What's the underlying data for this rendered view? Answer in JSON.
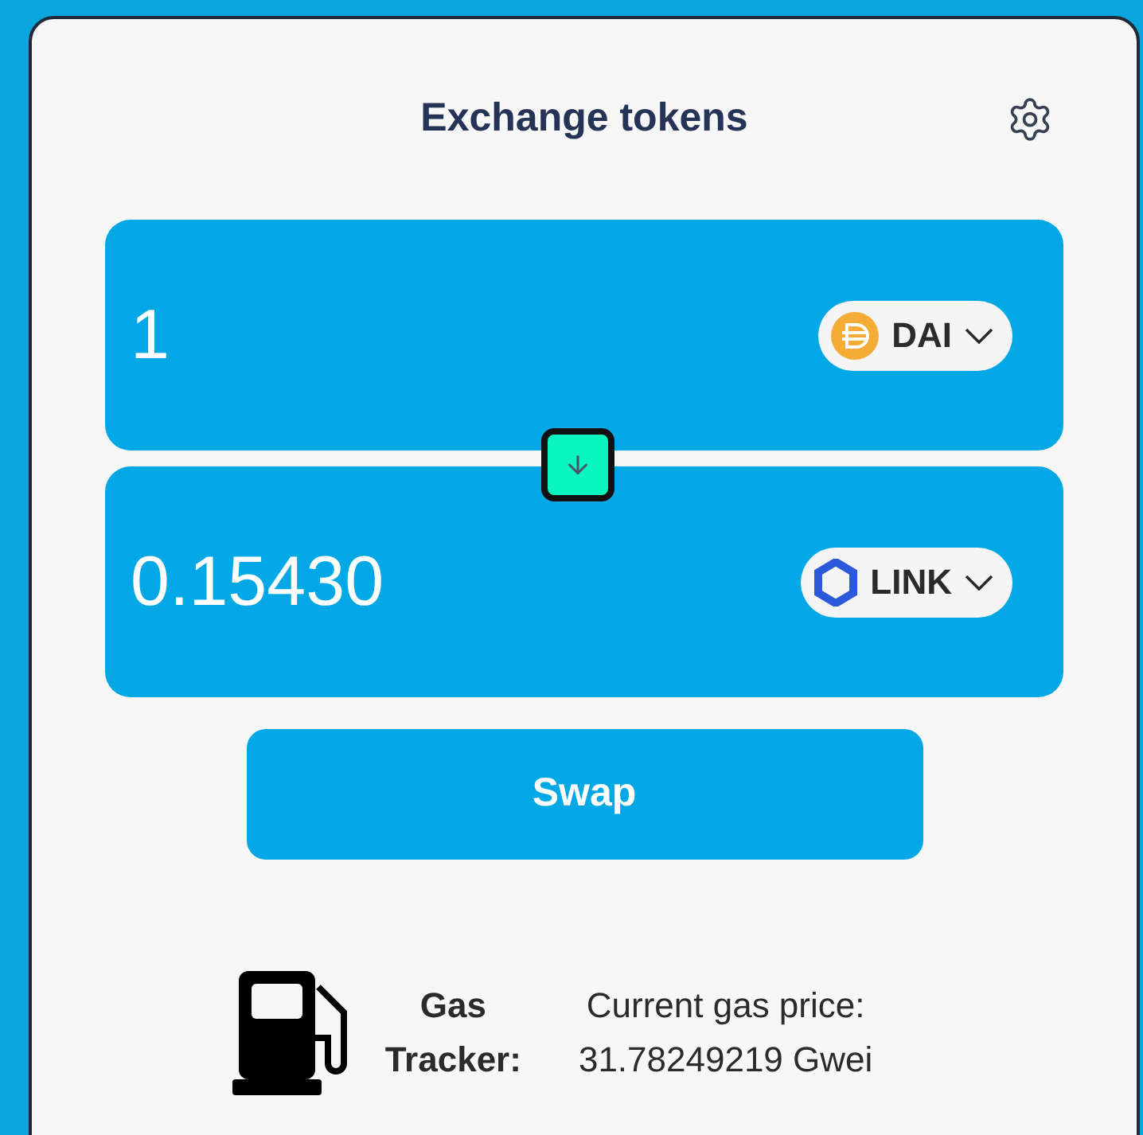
{
  "title": "Exchange tokens",
  "from": {
    "value": "1",
    "token": {
      "symbol": "DAI",
      "kind": "dai"
    }
  },
  "to": {
    "value": "0.15430",
    "token": {
      "symbol": "LINK",
      "kind": "link"
    }
  },
  "swap_button": "Swap",
  "gas": {
    "label_line_1": "Gas",
    "label_line_2": "Tracker:",
    "price_label": "Current gas price:",
    "price": "31.78249219 Gwei"
  }
}
